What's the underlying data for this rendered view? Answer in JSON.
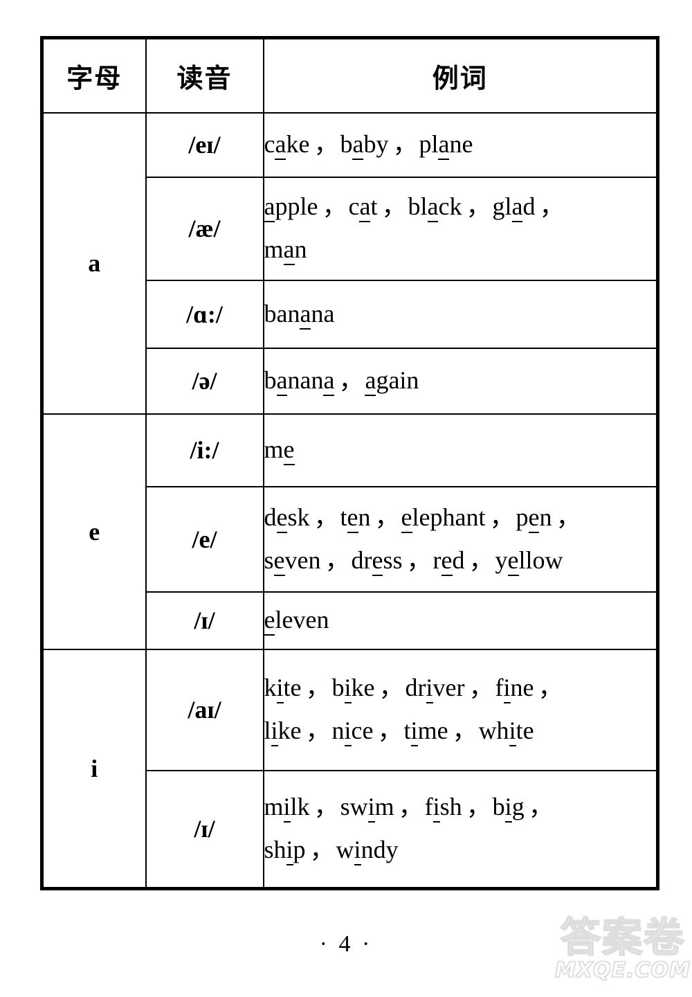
{
  "document": {
    "page_number": "· 4 ·"
  },
  "table": {
    "headers": {
      "letter": "字母",
      "sound": "读音",
      "words": "例词"
    },
    "groups": [
      {
        "letter": "a",
        "rows": [
          {
            "sound": "/eɪ/",
            "words_plain": "cake，baby，plane",
            "lines": [
              [
                {
                  "pre": "c",
                  "mark": "a",
                  "post": "ke",
                  "sep": "，"
                },
                {
                  "pre": "b",
                  "mark": "a",
                  "post": "by",
                  "sep": "，"
                },
                {
                  "pre": "pl",
                  "mark": "a",
                  "post": "ne",
                  "sep": ""
                }
              ]
            ]
          },
          {
            "sound": "/æ/",
            "words_plain": "apple，cat，black，glad，man",
            "lines": [
              [
                {
                  "pre": "",
                  "mark": "a",
                  "post": "pple",
                  "sep": "，"
                },
                {
                  "pre": "c",
                  "mark": "a",
                  "post": "t",
                  "sep": "，"
                },
                {
                  "pre": "bl",
                  "mark": "a",
                  "post": "ck",
                  "sep": "，"
                },
                {
                  "pre": "gl",
                  "mark": "a",
                  "post": "d",
                  "sep": "，"
                }
              ],
              [
                {
                  "pre": "m",
                  "mark": "a",
                  "post": "n",
                  "sep": ""
                }
              ]
            ]
          },
          {
            "sound": "/ɑ:/",
            "words_plain": "banana",
            "lines": [
              [
                {
                  "pre": "ban",
                  "mark": "a",
                  "post": "na",
                  "sep": ""
                }
              ]
            ]
          },
          {
            "sound": "/ə/",
            "words_plain": "banana，again",
            "lines": [
              [
                {
                  "pre": "b",
                  "mark": "a",
                  "post": "nan",
                  "mark2": "a",
                  "post2": "",
                  "sep": "，"
                },
                {
                  "pre": "",
                  "mark": "a",
                  "post": "gain",
                  "sep": ""
                }
              ]
            ]
          }
        ]
      },
      {
        "letter": "e",
        "rows": [
          {
            "sound": "/i:/",
            "words_plain": "me",
            "lines": [
              [
                {
                  "pre": "m",
                  "mark": "e",
                  "post": "",
                  "sep": ""
                }
              ]
            ]
          },
          {
            "sound": "/e/",
            "words_plain": "desk，ten，elephant，pen，seven，dress，red，yellow",
            "lines": [
              [
                {
                  "pre": "d",
                  "mark": "e",
                  "post": "sk",
                  "sep": "，"
                },
                {
                  "pre": "t",
                  "mark": "e",
                  "post": "n",
                  "sep": "，"
                },
                {
                  "pre": "",
                  "mark": "e",
                  "post": "lephant",
                  "sep": "，"
                },
                {
                  "pre": "p",
                  "mark": "e",
                  "post": "n",
                  "sep": "，"
                }
              ],
              [
                {
                  "pre": "s",
                  "mark": "e",
                  "post": "ven",
                  "sep": "，"
                },
                {
                  "pre": "dr",
                  "mark": "e",
                  "post": "ss",
                  "sep": "，"
                },
                {
                  "pre": "r",
                  "mark": "e",
                  "post": "d",
                  "sep": "，"
                },
                {
                  "pre": "y",
                  "mark": "e",
                  "post": "llow",
                  "sep": ""
                }
              ]
            ]
          },
          {
            "sound": "/ɪ/",
            "words_plain": "eleven",
            "lines": [
              [
                {
                  "pre": "",
                  "mark": "e",
                  "post": "leven",
                  "sep": ""
                }
              ]
            ]
          }
        ]
      },
      {
        "letter": "i",
        "rows": [
          {
            "sound": "/aɪ/",
            "words_plain": "kite，bike，driver，fine，like，nice，time，white",
            "lines": [
              [
                {
                  "pre": "k",
                  "mark": "i",
                  "post": "te",
                  "sep": "，"
                },
                {
                  "pre": "b",
                  "mark": "i",
                  "post": "ke",
                  "sep": "，"
                },
                {
                  "pre": "dr",
                  "mark": "i",
                  "post": "ver",
                  "sep": "，"
                },
                {
                  "pre": "f",
                  "mark": "i",
                  "post": "ne",
                  "sep": "，"
                }
              ],
              [
                {
                  "pre": "l",
                  "mark": "i",
                  "post": "ke",
                  "sep": "，"
                },
                {
                  "pre": "n",
                  "mark": "i",
                  "post": "ce",
                  "sep": "，"
                },
                {
                  "pre": "t",
                  "mark": "i",
                  "post": "me",
                  "sep": "，"
                },
                {
                  "pre": "wh",
                  "mark": "i",
                  "post": "te",
                  "sep": ""
                }
              ]
            ]
          },
          {
            "sound": "/ɪ/",
            "words_plain": "milk，swim，fish，big，ship，windy",
            "lines": [
              [
                {
                  "pre": "m",
                  "mark": "i",
                  "post": "lk",
                  "sep": "，"
                },
                {
                  "pre": "sw",
                  "mark": "i",
                  "post": "m",
                  "sep": "，"
                },
                {
                  "pre": "f",
                  "mark": "i",
                  "post": "sh",
                  "sep": "，"
                },
                {
                  "pre": "b",
                  "mark": "i",
                  "post": "g",
                  "sep": "，"
                }
              ],
              [
                {
                  "pre": "sh",
                  "mark": "i",
                  "post": "p",
                  "sep": "，"
                },
                {
                  "pre": "w",
                  "mark": "i",
                  "post": "ndy",
                  "sep": ""
                }
              ]
            ]
          }
        ]
      }
    ]
  },
  "watermark": {
    "chinese": "答案卷",
    "site": "MXQE.COM"
  }
}
